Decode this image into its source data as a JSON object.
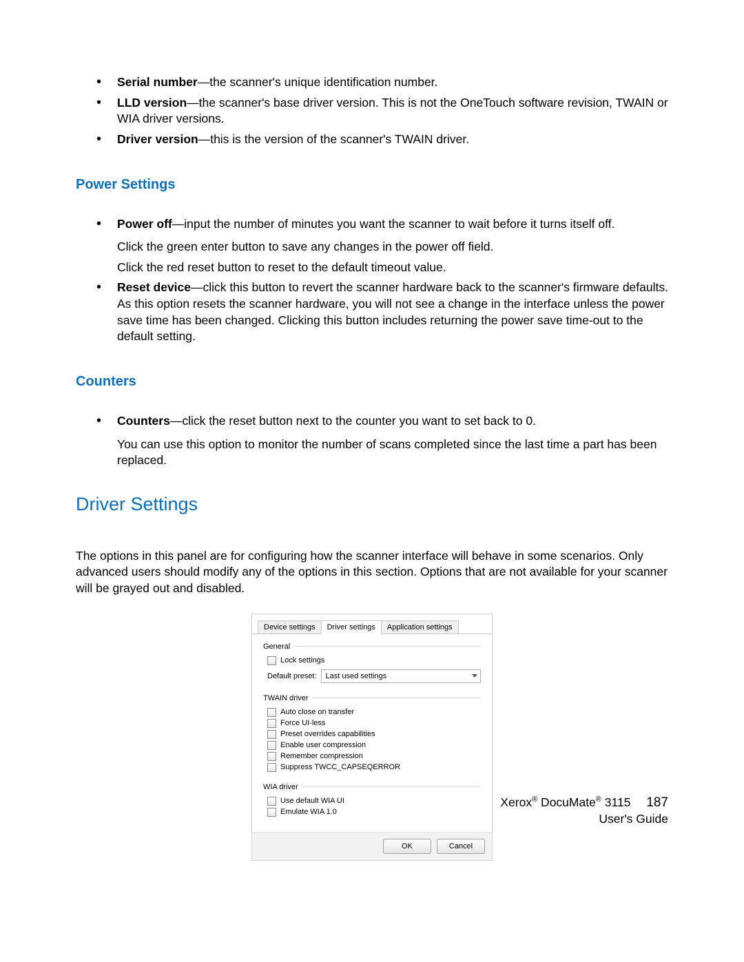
{
  "top_items": [
    {
      "term": "Serial number",
      "desc": "—the scanner's unique identification number."
    },
    {
      "term": "LLD version",
      "desc": "—the scanner's base driver version. This is not the OneTouch software revision, TWAIN or WIA driver versions."
    },
    {
      "term": "Driver version",
      "desc": "—this is the version of the scanner's TWAIN driver."
    }
  ],
  "power": {
    "heading": "Power Settings",
    "items": [
      {
        "term": "Power off",
        "desc": "—input the number of minutes you want the scanner to wait before it turns itself off.",
        "extras": [
          "Click the green enter button to save any changes in the power off field.",
          "Click the red reset button to reset to the default timeout value."
        ]
      },
      {
        "term": "Reset device",
        "desc": "—click this button to revert the scanner hardware back to the scanner's firmware defaults. As this option resets the scanner hardware, you will not see a change in the interface unless the power save time has been changed. Clicking this button includes returning the power save time-out to the default setting.",
        "extras": []
      }
    ]
  },
  "counters": {
    "heading": "Counters",
    "items": [
      {
        "term": "Counters",
        "desc": "—click the reset button next to the counter you want to set back to 0.",
        "extras": [
          "You can use this option to monitor the number of scans completed since the last time a part has been replaced."
        ]
      }
    ]
  },
  "driver": {
    "heading": "Driver Settings",
    "intro": "The options in this panel are for configuring how the scanner interface will behave in some scenarios. Only advanced users should modify any of the options in this section. Options that are not available for your scanner will be grayed out and disabled."
  },
  "dialog": {
    "tabs": [
      "Device settings",
      "Driver settings",
      "Application settings"
    ],
    "active_tab": 1,
    "general": {
      "title": "General",
      "lock": "Lock settings",
      "preset_label": "Default preset:",
      "preset_value": "Last used settings"
    },
    "twain": {
      "title": "TWAIN driver",
      "opts": [
        "Auto close on transfer",
        "Force UI-less",
        "Preset overrides capabilities",
        "Enable user compression",
        "Remember compression",
        "Suppress TWCC_CAPSEQERROR"
      ]
    },
    "wia": {
      "title": "WIA driver",
      "opts": [
        "Use default WIA UI",
        "Emulate WIA 1.0"
      ]
    },
    "ok": "OK",
    "cancel": "Cancel"
  },
  "footer": {
    "line1_a": "Xerox",
    "line1_b": " DocuMate",
    "line1_c": " 3115",
    "page": "187",
    "line2": "User's Guide"
  }
}
